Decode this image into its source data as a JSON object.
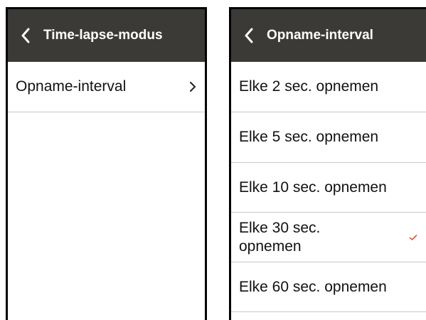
{
  "left_screen": {
    "header": {
      "title": "Time-lapse-modus",
      "back_icon": "chevron-left-icon"
    },
    "items": [
      {
        "label": "Opname-interval",
        "icon": "chevron-right-icon"
      }
    ]
  },
  "right_screen": {
    "header": {
      "title": "Opname-interval",
      "back_icon": "chevron-left-icon"
    },
    "items": [
      {
        "label": "Elke 2 sec. opnemen",
        "selected": false
      },
      {
        "label": "Elke 5 sec. opnemen",
        "selected": false
      },
      {
        "label": "Elke 10 sec. opnemen",
        "selected": false
      },
      {
        "label": "Elke 30 sec. opnemen",
        "selected": true
      },
      {
        "label": "Elke 60 sec. opnemen",
        "selected": false
      }
    ]
  },
  "colors": {
    "header_bg": "#3b3a36",
    "divider": "#c8c8c8",
    "check": "#e2552f"
  }
}
